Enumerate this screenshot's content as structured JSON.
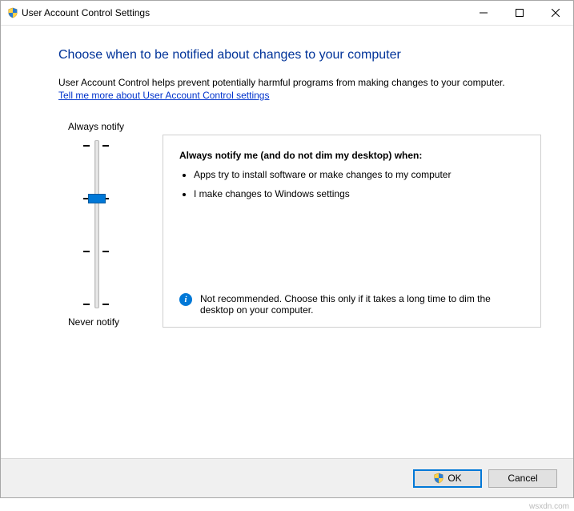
{
  "window": {
    "title": "User Account Control Settings"
  },
  "heading": "Choose when to be notified about changes to your computer",
  "subtext": "User Account Control helps prevent potentially harmful programs from making changes to your computer.",
  "link": "Tell me more about User Account Control settings",
  "slider": {
    "topLabel": "Always notify",
    "bottomLabel": "Never notify",
    "levels": 4,
    "selectedIndex": 1
  },
  "description": {
    "title": "Always notify me (and do not dim my desktop) when:",
    "bullets": [
      "Apps try to install software or make changes to my computer",
      "I make changes to Windows settings"
    ],
    "recommendation": "Not recommended. Choose this only if it takes a long time to dim the desktop on your computer."
  },
  "buttons": {
    "ok": "OK",
    "cancel": "Cancel"
  },
  "watermark": "wsxdn.com"
}
